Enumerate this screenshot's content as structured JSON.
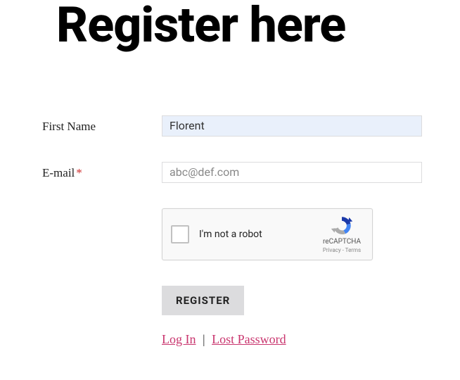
{
  "title": "Register here",
  "fields": {
    "first_name": {
      "label": "First Name",
      "value": "Florent",
      "required": false
    },
    "email": {
      "label": "E-mail",
      "placeholder": "abc@def.com",
      "required": true,
      "required_mark": "*"
    }
  },
  "recaptcha": {
    "label": "I'm not a robot",
    "brand": "reCAPTCHA",
    "legal": "Privacy - Terms"
  },
  "submit": {
    "label": "REGISTER"
  },
  "links": {
    "login": "Log In",
    "separator": "|",
    "lost_password": "Lost Password"
  }
}
